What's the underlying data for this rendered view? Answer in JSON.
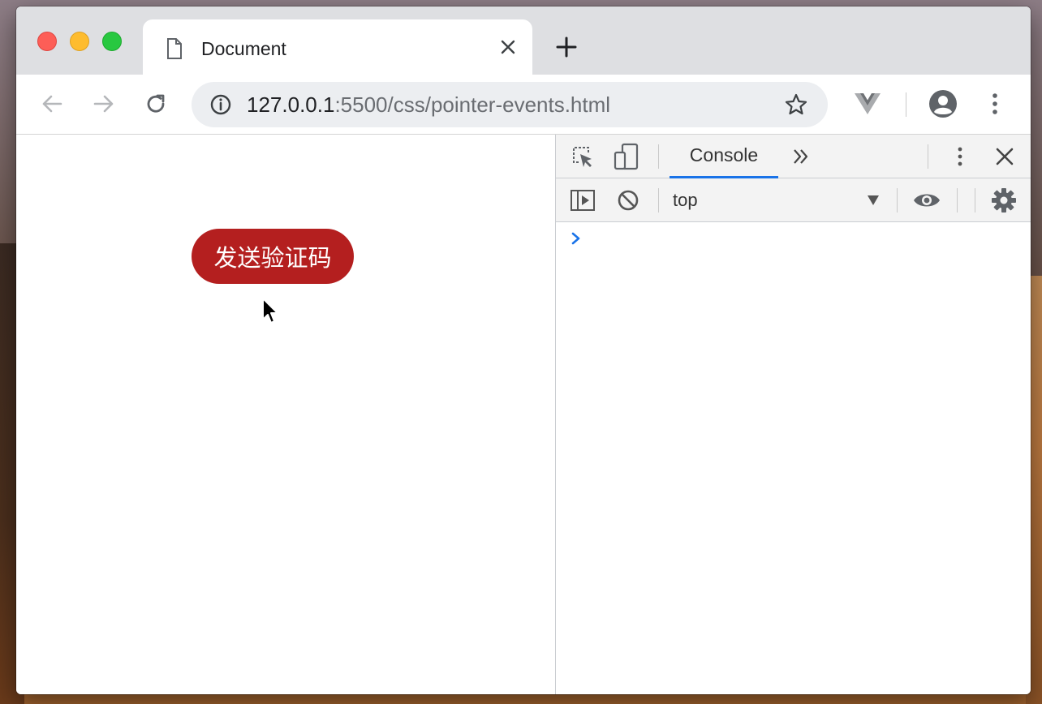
{
  "tab": {
    "title": "Document",
    "close_icon": "close-icon",
    "doc_icon": "document-icon"
  },
  "new_tab_icon": "plus-icon",
  "toolbar": {
    "back_icon": "arrow-left-icon",
    "forward_icon": "arrow-right-icon",
    "reload_icon": "reload-icon",
    "url_host": "127.0.0.1",
    "url_path": ":5500/css/pointer-events.html",
    "info_icon": "info-icon",
    "star_icon": "star-icon",
    "extension_icon": "vue-devtools-icon",
    "profile_icon": "account-icon",
    "menu_icon": "kebab-menu-icon"
  },
  "page": {
    "send_code_label": "发送验证码",
    "button_color": "#b41f1f"
  },
  "devtools": {
    "tabs": [
      "Console"
    ],
    "active_tab": "Console",
    "context": "top",
    "accent": "#1a73e8"
  }
}
